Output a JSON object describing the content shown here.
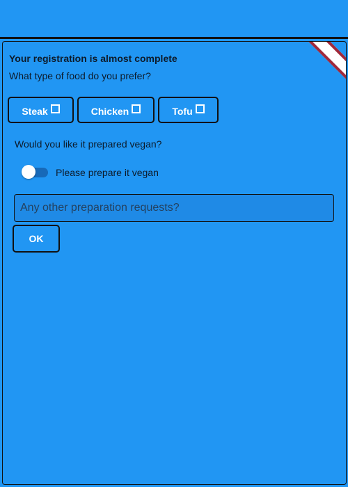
{
  "dialog": {
    "title": "Your registration is almost complete",
    "food_question": "What type of food do you prefer?",
    "food_options": [
      {
        "label": "Steak",
        "checked": false
      },
      {
        "label": "Chicken",
        "checked": false
      },
      {
        "label": "Tofu",
        "checked": false
      }
    ],
    "vegan_question": "Would you like it prepared vegan?",
    "vegan_toggle": {
      "label": "Please prepare it vegan",
      "on": false
    },
    "requests_input": {
      "placeholder": "Any other preparation requests?",
      "value": ""
    },
    "ok_label": "OK"
  },
  "colors": {
    "background": "#2196f3",
    "text": "#0d1b2a",
    "button_text": "#ffffff",
    "border": "#111111",
    "toggle_track": "#1769b8",
    "debug_banner": "#a0283a"
  }
}
